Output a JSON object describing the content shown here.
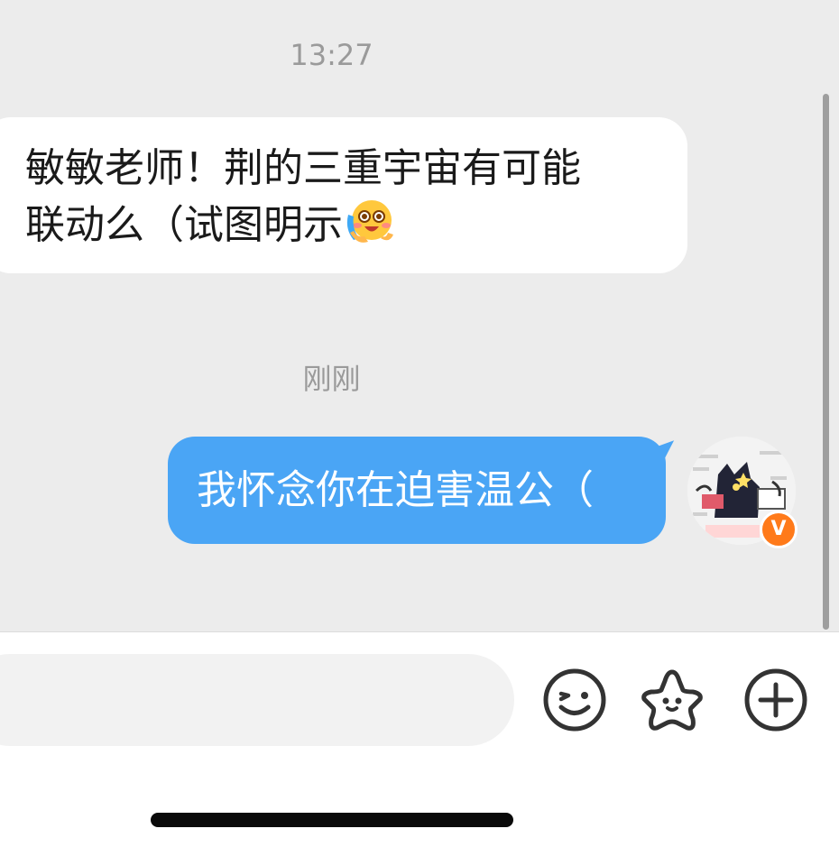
{
  "chat": {
    "timestamp_1": "13:27",
    "timestamp_2": "刚刚",
    "incoming_message": {
      "line1": "敏敏老师！荆的三重宇宙有可能",
      "line2": "联动么（试图明示",
      "emoji": "hugging-face-emoji"
    },
    "outgoing_message": {
      "text": "我怀念你在迫害温公（"
    },
    "avatar": {
      "badge": "V"
    }
  },
  "input_bar": {
    "message_value": "",
    "emoji_button": "smiley-icon",
    "sticker_button": "star-sticker-icon",
    "more_button": "plus-icon"
  },
  "colors": {
    "chat_background": "#ececec",
    "incoming_bubble": "#ffffff",
    "outgoing_bubble": "#4aa5f5",
    "verified_badge": "#ff7a1a"
  }
}
